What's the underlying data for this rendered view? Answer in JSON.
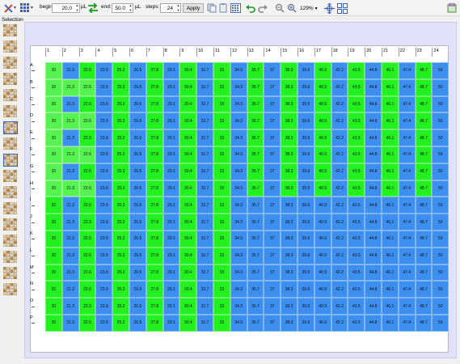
{
  "toolbar": {
    "begin_label": "begin:",
    "begin_value": "20.0",
    "begin_unit": "µL",
    "end_label": "end:",
    "end_value": "50.0",
    "end_unit": "µL",
    "steps_label": "steps:",
    "steps_value": "24",
    "apply_label": "Apply",
    "zoom_value": "129%"
  },
  "selection_label": "Selection",
  "plate": {
    "columns": [
      "1",
      "2",
      "3",
      "4",
      "5",
      "6",
      "7",
      "8",
      "9",
      "10",
      "11",
      "12",
      "13",
      "14",
      "15",
      "16",
      "17",
      "18",
      "19",
      "20",
      "21",
      "22",
      "23",
      "24"
    ],
    "rows": [
      "A",
      "B",
      "C",
      "D",
      "E",
      "F",
      "G",
      "H",
      "I",
      "J",
      "K",
      "L",
      "M",
      "N",
      "O",
      "P"
    ],
    "values": [
      "20",
      "21.3",
      "22.6",
      "23.9",
      "25.2",
      "26.5",
      "27.8",
      "29.1",
      "30.4",
      "31.7",
      "33",
      "34.3",
      "35.7",
      "37",
      "38.3",
      "39.6",
      "40.9",
      "42.2",
      "43.5",
      "44.8",
      "46.1",
      "47.4",
      "48.7",
      "50"
    ]
  },
  "colors": {
    "blue": "#3d8fef",
    "green": "#22f01f",
    "light_green": "#55f250"
  }
}
